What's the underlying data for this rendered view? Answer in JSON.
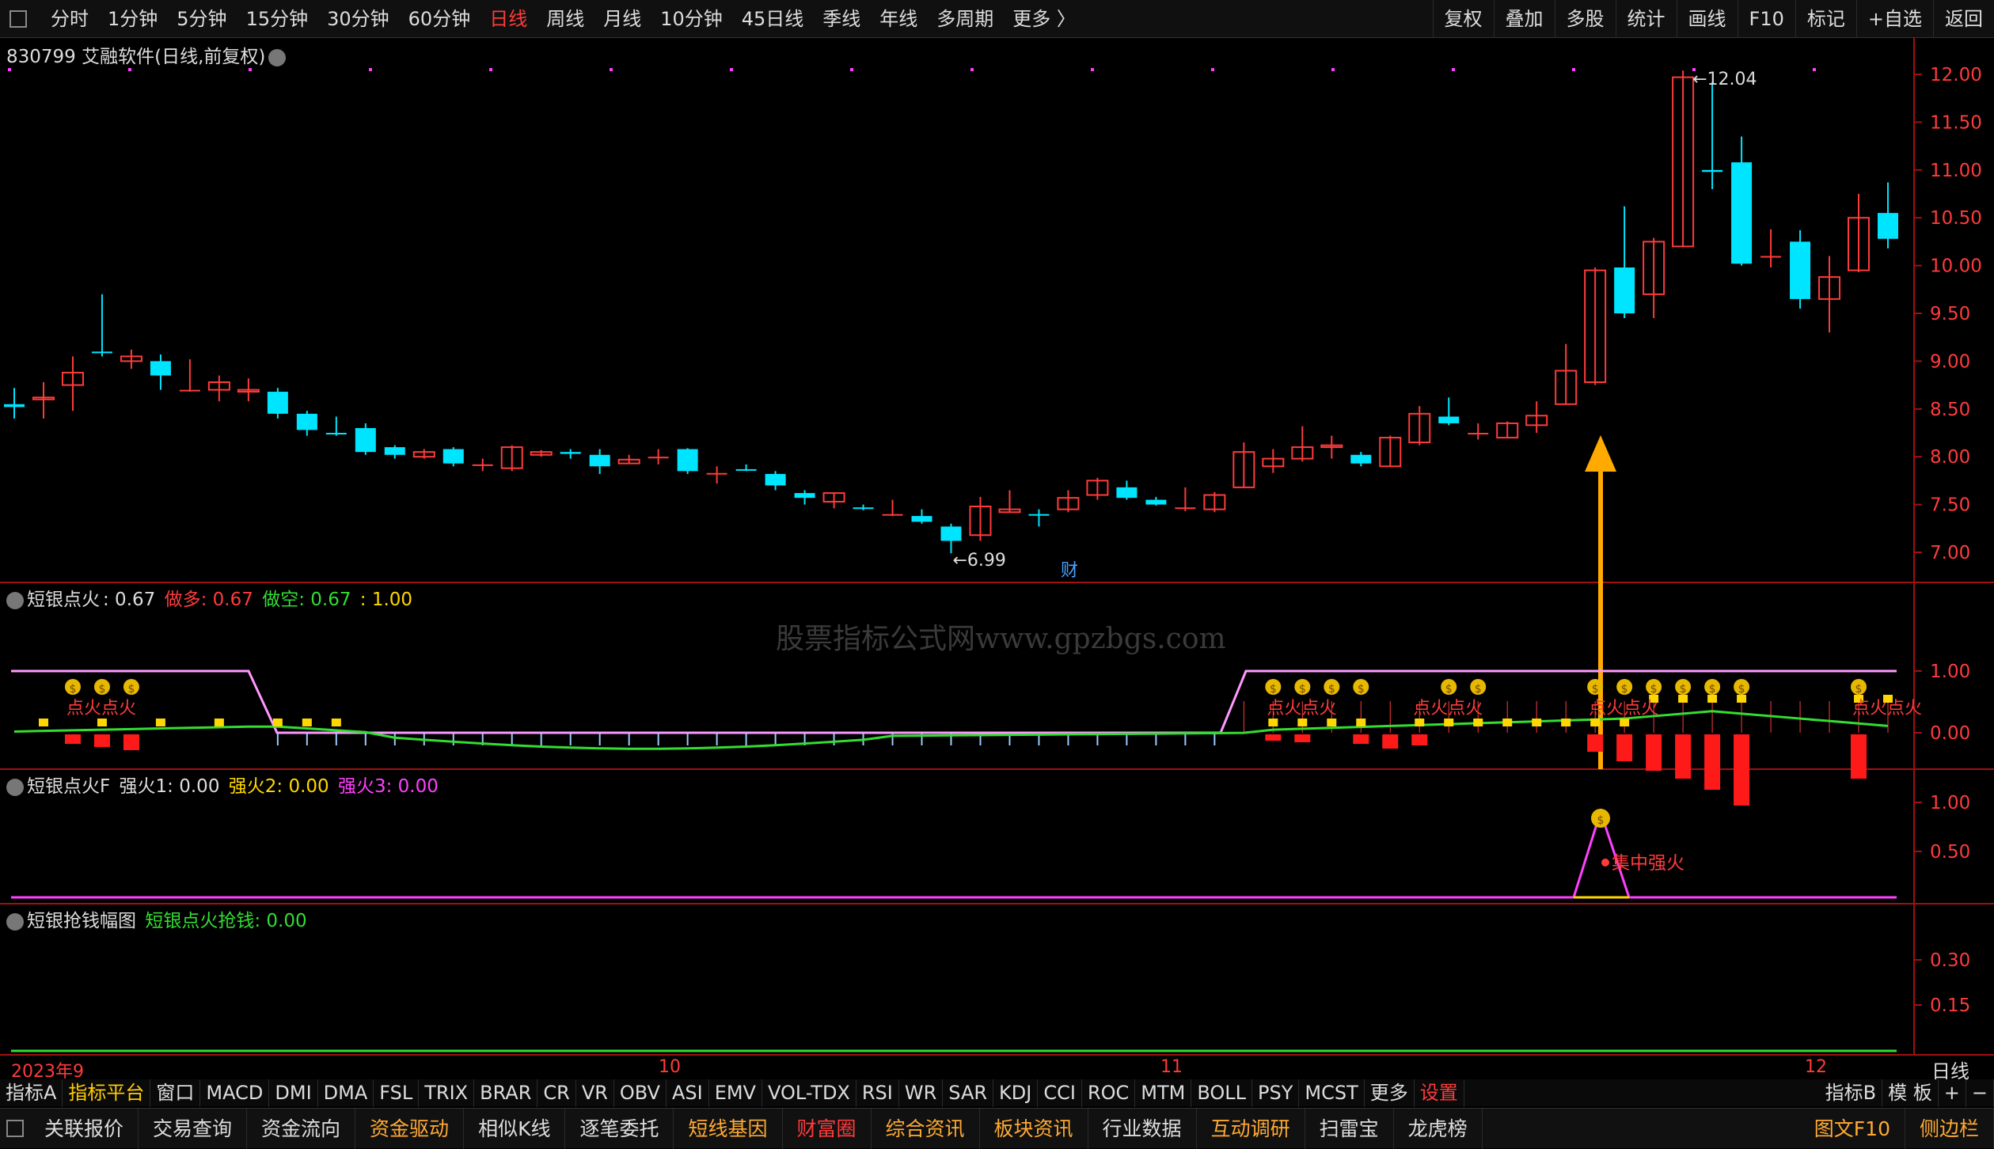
{
  "topbar": {
    "periods": [
      "分时",
      "1分钟",
      "5分钟",
      "15分钟",
      "30分钟",
      "60分钟",
      "日线",
      "周线",
      "月线",
      "10分钟",
      "45日线",
      "季线",
      "年线",
      "多周期",
      "更多 〉"
    ],
    "active_period": "日线",
    "right_buttons": [
      "复权",
      "叠加",
      "多股",
      "统计",
      "画线",
      "F10",
      "标记",
      "+自选",
      "返回"
    ]
  },
  "main_chart": {
    "title": "830799 艾融软件(日线,前复权)",
    "price_labels": [
      "12.00",
      "11.50",
      "11.00",
      "10.50",
      "10.00",
      "9.50",
      "9.00",
      "8.50",
      "8.00",
      "7.50",
      "7.00"
    ],
    "high_marker": "12.04",
    "low_marker": "6.99",
    "cai_label": "财",
    "candles": [
      {
        "o": 8.55,
        "c": 8.52,
        "h": 8.72,
        "l": 8.4
      },
      {
        "o": 8.6,
        "c": 8.62,
        "h": 8.78,
        "l": 8.4
      },
      {
        "o": 8.75,
        "c": 8.88,
        "h": 9.05,
        "l": 8.48
      },
      {
        "o": 9.1,
        "c": 9.1,
        "h": 9.7,
        "l": 9.05
      },
      {
        "o": 9.0,
        "c": 9.05,
        "h": 9.12,
        "l": 8.92
      },
      {
        "o": 9.0,
        "c": 8.85,
        "h": 9.07,
        "l": 8.7
      },
      {
        "o": 8.7,
        "c": 8.7,
        "h": 9.02,
        "l": 8.68
      },
      {
        "o": 8.7,
        "c": 8.78,
        "h": 8.85,
        "l": 8.58
      },
      {
        "o": 8.68,
        "c": 8.7,
        "h": 8.82,
        "l": 8.58
      },
      {
        "o": 8.68,
        "c": 8.45,
        "h": 8.72,
        "l": 8.4
      },
      {
        "o": 8.45,
        "c": 8.28,
        "h": 8.48,
        "l": 8.22
      },
      {
        "o": 8.25,
        "c": 8.25,
        "h": 8.42,
        "l": 8.22
      },
      {
        "o": 8.3,
        "c": 8.05,
        "h": 8.35,
        "l": 8.02
      },
      {
        "o": 8.1,
        "c": 8.02,
        "h": 8.12,
        "l": 7.98
      },
      {
        "o": 8.0,
        "c": 8.05,
        "h": 8.08,
        "l": 7.98
      },
      {
        "o": 8.08,
        "c": 7.93,
        "h": 8.1,
        "l": 7.9
      },
      {
        "o": 7.92,
        "c": 7.92,
        "h": 7.98,
        "l": 7.85
      },
      {
        "o": 7.88,
        "c": 8.1,
        "h": 8.12,
        "l": 7.85
      },
      {
        "o": 8.02,
        "c": 8.05,
        "h": 8.07,
        "l": 8.0
      },
      {
        "o": 8.05,
        "c": 8.03,
        "h": 8.08,
        "l": 7.98
      },
      {
        "o": 8.02,
        "c": 7.9,
        "h": 8.08,
        "l": 7.82
      },
      {
        "o": 7.93,
        "c": 7.97,
        "h": 8.02,
        "l": 7.93
      },
      {
        "o": 8.0,
        "c": 8.0,
        "h": 8.08,
        "l": 7.92
      },
      {
        "o": 8.08,
        "c": 7.85,
        "h": 8.09,
        "l": 7.82
      },
      {
        "o": 7.83,
        "c": 7.83,
        "h": 7.9,
        "l": 7.72
      },
      {
        "o": 7.87,
        "c": 7.87,
        "h": 7.92,
        "l": 7.85
      },
      {
        "o": 7.82,
        "c": 7.7,
        "h": 7.85,
        "l": 7.65
      },
      {
        "o": 7.62,
        "c": 7.57,
        "h": 7.65,
        "l": 7.5
      },
      {
        "o": 7.53,
        "c": 7.62,
        "h": 7.62,
        "l": 7.46
      },
      {
        "o": 7.47,
        "c": 7.47,
        "h": 7.5,
        "l": 7.44
      },
      {
        "o": 7.4,
        "c": 7.4,
        "h": 7.55,
        "l": 7.38
      },
      {
        "o": 7.38,
        "c": 7.32,
        "h": 7.45,
        "l": 7.3
      },
      {
        "o": 7.27,
        "c": 7.12,
        "h": 7.3,
        "l": 6.99
      },
      {
        "o": 7.18,
        "c": 7.48,
        "h": 7.58,
        "l": 7.12
      },
      {
        "o": 7.42,
        "c": 7.45,
        "h": 7.65,
        "l": 7.42
      },
      {
        "o": 7.4,
        "c": 7.4,
        "h": 7.45,
        "l": 7.27
      },
      {
        "o": 7.45,
        "c": 7.57,
        "h": 7.65,
        "l": 7.42
      },
      {
        "o": 7.6,
        "c": 7.75,
        "h": 7.78,
        "l": 7.55
      },
      {
        "o": 7.68,
        "c": 7.57,
        "h": 7.75,
        "l": 7.55
      },
      {
        "o": 7.55,
        "c": 7.5,
        "h": 7.58,
        "l": 7.49
      },
      {
        "o": 7.47,
        "c": 7.47,
        "h": 7.68,
        "l": 7.43
      },
      {
        "o": 7.45,
        "c": 7.6,
        "h": 7.63,
        "l": 7.42
      },
      {
        "o": 7.68,
        "c": 8.05,
        "h": 8.15,
        "l": 7.68
      },
      {
        "o": 7.9,
        "c": 7.98,
        "h": 8.08,
        "l": 7.83
      },
      {
        "o": 7.98,
        "c": 8.1,
        "h": 8.32,
        "l": 7.95
      },
      {
        "o": 8.1,
        "c": 8.12,
        "h": 8.22,
        "l": 7.98
      },
      {
        "o": 8.02,
        "c": 7.93,
        "h": 8.05,
        "l": 7.9
      },
      {
        "o": 7.9,
        "c": 8.2,
        "h": 8.22,
        "l": 7.9
      },
      {
        "o": 8.15,
        "c": 8.45,
        "h": 8.53,
        "l": 8.12
      },
      {
        "o": 8.42,
        "c": 8.35,
        "h": 8.62,
        "l": 8.33
      },
      {
        "o": 8.25,
        "c": 8.25,
        "h": 8.35,
        "l": 8.18
      },
      {
        "o": 8.2,
        "c": 8.35,
        "h": 8.37,
        "l": 8.2
      },
      {
        "o": 8.33,
        "c": 8.43,
        "h": 8.58,
        "l": 8.25
      },
      {
        "o": 8.55,
        "c": 8.9,
        "h": 9.18,
        "l": 8.55
      },
      {
        "o": 8.78,
        "c": 9.95,
        "h": 9.98,
        "l": 8.75
      },
      {
        "o": 9.98,
        "c": 9.5,
        "h": 10.62,
        "l": 9.45
      },
      {
        "o": 9.7,
        "c": 10.25,
        "h": 10.29,
        "l": 9.45
      },
      {
        "o": 10.2,
        "c": 11.97,
        "h": 12.04,
        "l": 10.2
      },
      {
        "o": 11.0,
        "c": 10.98,
        "h": 11.92,
        "l": 10.8
      },
      {
        "o": 11.08,
        "c": 10.02,
        "h": 11.35,
        "l": 10.0
      },
      {
        "o": 10.1,
        "c": 10.1,
        "h": 10.38,
        "l": 9.98
      },
      {
        "o": 10.25,
        "c": 9.65,
        "h": 10.37,
        "l": 9.55
      },
      {
        "o": 9.65,
        "c": 9.88,
        "h": 10.1,
        "l": 9.3
      },
      {
        "o": 9.95,
        "c": 10.5,
        "h": 10.75,
        "l": 9.93
      },
      {
        "o": 10.55,
        "c": 10.28,
        "h": 10.87,
        "l": 10.18
      }
    ]
  },
  "panel1": {
    "name": "短银点火",
    "value": ": 0.67",
    "zuoduo": "做多: 0.67",
    "zuokong": "做空: 0.67",
    "extra": ": 1.00",
    "axis": [
      "1.00",
      "0.00"
    ],
    "fire_label": "点火"
  },
  "panel2": {
    "name": "短银点火F",
    "q1": "强火1: 0.00",
    "q2": "强火2: 0.00",
    "q3": "强火3: 0.00",
    "axis": [
      "1.00",
      "0.50"
    ],
    "signal": "集中强火"
  },
  "panel3": {
    "name": "短银抢钱幅图",
    "value": "短银点火抢钱: 0.00",
    "axis": [
      "0.30",
      "0.15"
    ]
  },
  "date_axis": [
    "2023年9",
    "10",
    "11",
    "12"
  ],
  "period_label": "日线",
  "watermark": "股票指标公式网www.gpzbgs.com",
  "tabbar1": {
    "items": [
      "指标A",
      "指标平台",
      "窗口",
      "MACD",
      "DMI",
      "DMA",
      "FSL",
      "TRIX",
      "BRAR",
      "CR",
      "VR",
      "OBV",
      "ASI",
      "EMV",
      "VOL-TDX",
      "RSI",
      "WR",
      "SAR",
      "KDJ",
      "CCI",
      "ROC",
      "MTM",
      "BOLL",
      "PSY",
      "MCST",
      "更多",
      "设置"
    ],
    "right": [
      "指标B",
      "模 板",
      "+",
      "−"
    ]
  },
  "tabbar2": {
    "items": [
      "关联报价",
      "交易查询",
      "资金流向",
      "资金驱动",
      "相似K线",
      "逐笔委托",
      "短线基因",
      "财富圈",
      "综合资讯",
      "板块资讯",
      "行业数据",
      "互动调研",
      "扫雷宝",
      "龙虎榜"
    ],
    "right": [
      "图文F10",
      "侧边栏"
    ]
  },
  "colors": {
    "up": "#ff3b3b",
    "down": "#00e5ff",
    "magenta": "#ff40ff",
    "yellow": "#ffd700",
    "green": "#33dd33",
    "pink_line": "#ff99ff",
    "axis_red": "#a01010"
  }
}
